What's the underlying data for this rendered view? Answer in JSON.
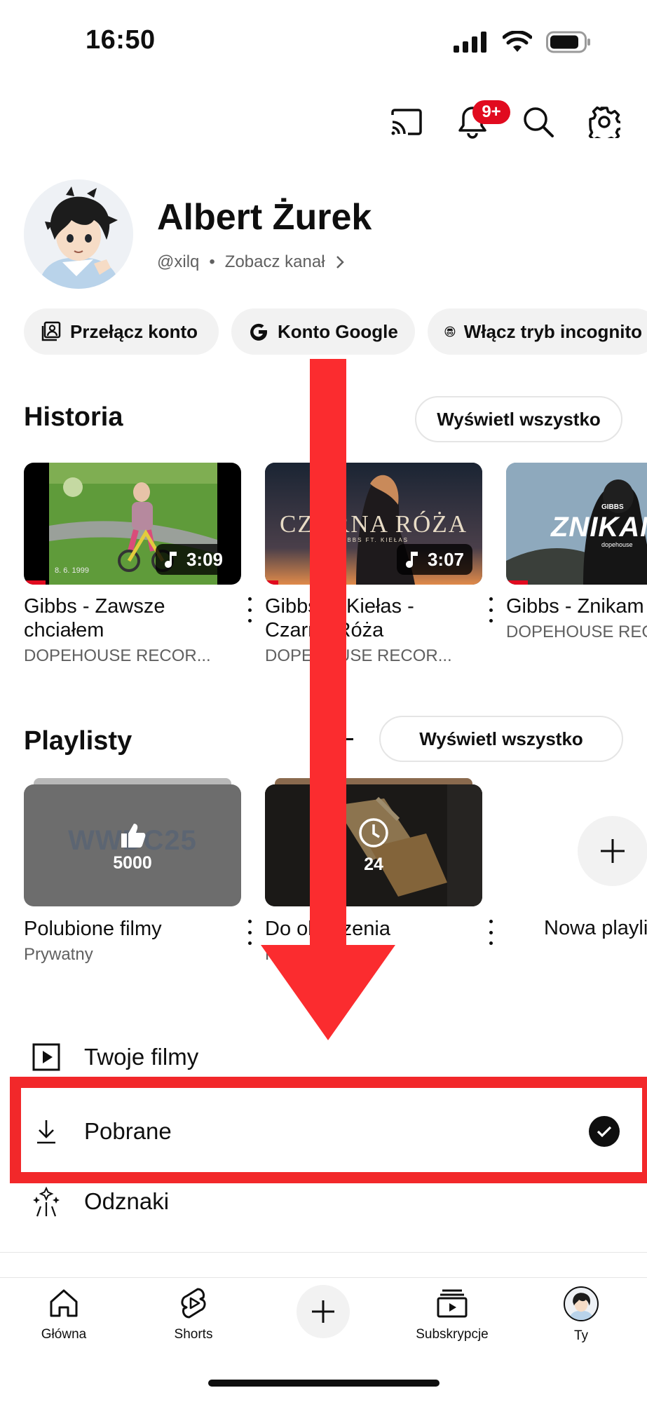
{
  "status_bar": {
    "time": "16:50"
  },
  "top_bar": {
    "notification_badge": "9+"
  },
  "profile": {
    "name": "Albert Żurek",
    "handle": "@xilq",
    "separator": "•",
    "view_channel": "Zobacz kanał"
  },
  "chips": [
    {
      "label": "Przełącz konto",
      "icon": "switch-account-icon"
    },
    {
      "label": "Konto Google",
      "icon": "google-g-icon"
    },
    {
      "label": "Włącz tryb incognito",
      "icon": "incognito-icon"
    }
  ],
  "history": {
    "title": "Historia",
    "view_all": "Wyświetl wszystko",
    "videos": [
      {
        "title": "Gibbs - Zawsze chciałem",
        "channel": "DOPEHOUSE RECOR...",
        "duration": "3:09",
        "watched": 0.1
      },
      {
        "title": "Gibbs ft. Kiełas - Czarna Róża",
        "channel": "DOPEHOUSE RECOR...",
        "duration": "3:07",
        "watched": 0.06
      },
      {
        "title": "Gibbs - Znikam",
        "channel": "DOPEHOUSE REC",
        "duration": "",
        "watched": 0.1
      }
    ],
    "thumb_texts": {
      "date_stamp": "8. 6. 1999",
      "czarna_roza": "CZARNA RÓŻA",
      "czarna_roza_sub": "GIBBS FT. KIEŁAS",
      "znikam": "ZNIKAM",
      "gibbs": "GIBBS",
      "dopehouse": "dopehouse"
    }
  },
  "playlists": {
    "title": "Playlisty",
    "view_all": "Wyświetl wszystko",
    "items": [
      {
        "title": "Polubione filmy",
        "subtitle": "Prywatny",
        "count": "5000",
        "thumb_text": "WWDC25"
      },
      {
        "title": "Do obejrzenia",
        "subtitle": "Prywatny",
        "count": "24"
      }
    ],
    "new_playlist": "Nowa playlista"
  },
  "menu": [
    {
      "label": "Twoje filmy",
      "icon": "play-box-icon"
    },
    {
      "label": "Pobrane",
      "icon": "download-icon",
      "downloaded": true
    },
    {
      "label": "Odznaki",
      "icon": "badges-icon"
    }
  ],
  "bottom_nav": [
    {
      "label": "Główna",
      "icon": "home-icon"
    },
    {
      "label": "Shorts",
      "icon": "shorts-icon"
    },
    {
      "label": "",
      "icon": "create-plus-icon"
    },
    {
      "label": "Subskrypcje",
      "icon": "subscriptions-icon"
    },
    {
      "label": "Ty",
      "icon": "profile-avatar-icon"
    }
  ],
  "annotation_colors": {
    "arrow": "#fb2c2f",
    "highlight_box": "#f2282a"
  }
}
